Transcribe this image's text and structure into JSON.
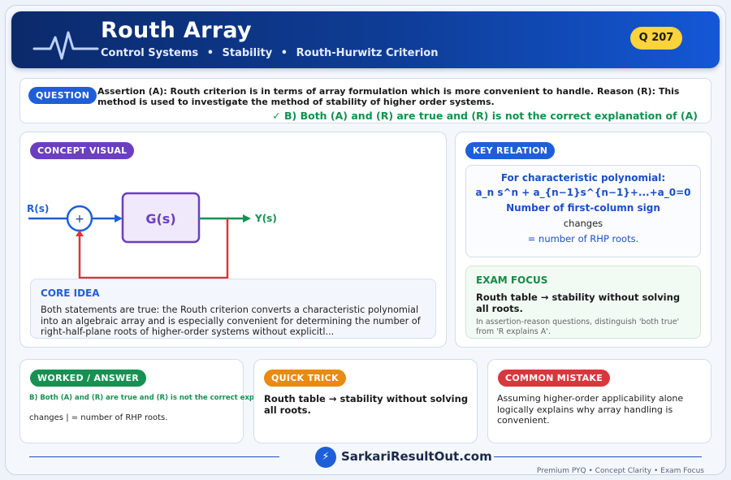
{
  "header": {
    "title": "Routh Array",
    "breadcrumbs": [
      "Control Systems",
      "Stability",
      "Routh-Hurwitz Criterion"
    ],
    "separator": "•",
    "question_number": "Q 207"
  },
  "question": {
    "label": "QUESTION",
    "text": "Assertion (A): Routh criterion is in terms of array formulation which is more convenient to handle. Reason (R): This method is used to investigate the method of stability of higher order systems.",
    "answer": "✓ B) Both (A) and (R) are true and (R) is not the correct explanation of (A)"
  },
  "concept_visual": {
    "label": "CONCEPT VISUAL",
    "diagram": {
      "input_label": "R(s)",
      "summing_sign": "+",
      "block_label": "G(s)",
      "output_label": "Y(s)"
    },
    "core_idea": {
      "heading": "CORE IDEA",
      "text": "Both statements are true: the Routh criterion converts a characteristic polynomial into an algebraic array and is especially convenient for determining the number of right-half-plane roots of higher-order systems without explicitl..."
    }
  },
  "key_relation": {
    "label": "KEY RELATION",
    "line1": "For characteristic polynomial:",
    "line2": "a_n s^n + a_{n−1}s^{n−1}+...+a_0=0",
    "line3": "Number of first-column sign",
    "line4": "changes",
    "line5": "= number of RHP roots."
  },
  "exam_focus": {
    "heading": "EXAM FOCUS",
    "bold": "Routh table → stability without solving all roots.",
    "small": "In assertion-reason questions, distinguish 'both true' from 'R explains A'."
  },
  "worked": {
    "label": "WORKED / ANSWER",
    "answer": "B) Both (A) and (R) are true and (R) is not the correct explanation of (A)",
    "line2": "changes | = number of RHP roots."
  },
  "quick_trick": {
    "label": "QUICK TRICK",
    "text": "Routh table → stability without solving all roots."
  },
  "common_mistake": {
    "label": "COMMON MISTAKE",
    "text": "Assuming higher-order applicability alone logically explains why array handling is convenient."
  },
  "footer": {
    "logo_icon": "⚡",
    "site": "SarkariResultOut.com",
    "tagline": "Premium PYQ • Concept Clarity • Exam Focus"
  },
  "colors": {
    "header_dark": "#0b2a6b",
    "header_light": "#1457d6",
    "badge_yellow": "#fbd33a",
    "accent_blue": "#1e5fd9",
    "accent_purple": "#6b3fbf",
    "accent_green": "#179152",
    "accent_orange": "#e88b12",
    "accent_red": "#d9363e"
  }
}
